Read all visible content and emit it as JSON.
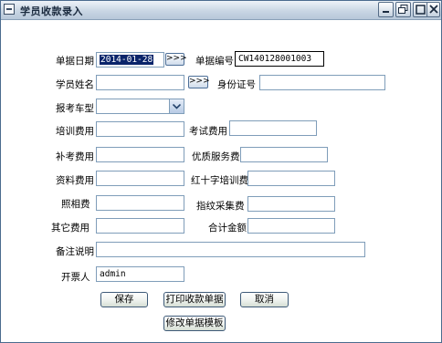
{
  "window": {
    "title": "学员收款录入"
  },
  "form": {
    "bill_date": {
      "label": "单据日期",
      "value": "2014-01-28"
    },
    "date_picker_button": ">>>",
    "bill_number": {
      "label": "单据编号",
      "value": "CW140128001003"
    },
    "student_name": {
      "label": "学员姓名",
      "value": ""
    },
    "lookup_button": ">>>",
    "id_number": {
      "label": "身份证号",
      "value": ""
    },
    "license_type": {
      "label": "报考车型",
      "value": ""
    },
    "training_fee": {
      "label": "培训费用",
      "value": ""
    },
    "exam_fee": {
      "label": "考试费用",
      "value": ""
    },
    "makeup_exam_fee": {
      "label": "补考费用",
      "value": ""
    },
    "premium_service_fee": {
      "label": "优质服务费",
      "value": ""
    },
    "materials_fee": {
      "label": "资料费用",
      "value": ""
    },
    "red_cross_training_fee": {
      "label": "红十字培训费",
      "value": ""
    },
    "photo_fee": {
      "label": "照相费",
      "value": ""
    },
    "fingerprint_fee": {
      "label": "指纹采集费",
      "value": ""
    },
    "other_fee": {
      "label": "其它费用",
      "value": ""
    },
    "total_amount": {
      "label": "合计金额",
      "value": ""
    },
    "remarks": {
      "label": "备注说明",
      "value": ""
    },
    "issuer": {
      "label": "开票人",
      "value": "admin"
    }
  },
  "buttons": {
    "save": "保存",
    "print_receipt": "打印收款单据",
    "cancel": "取消",
    "edit_template": "修改单据模板"
  }
}
